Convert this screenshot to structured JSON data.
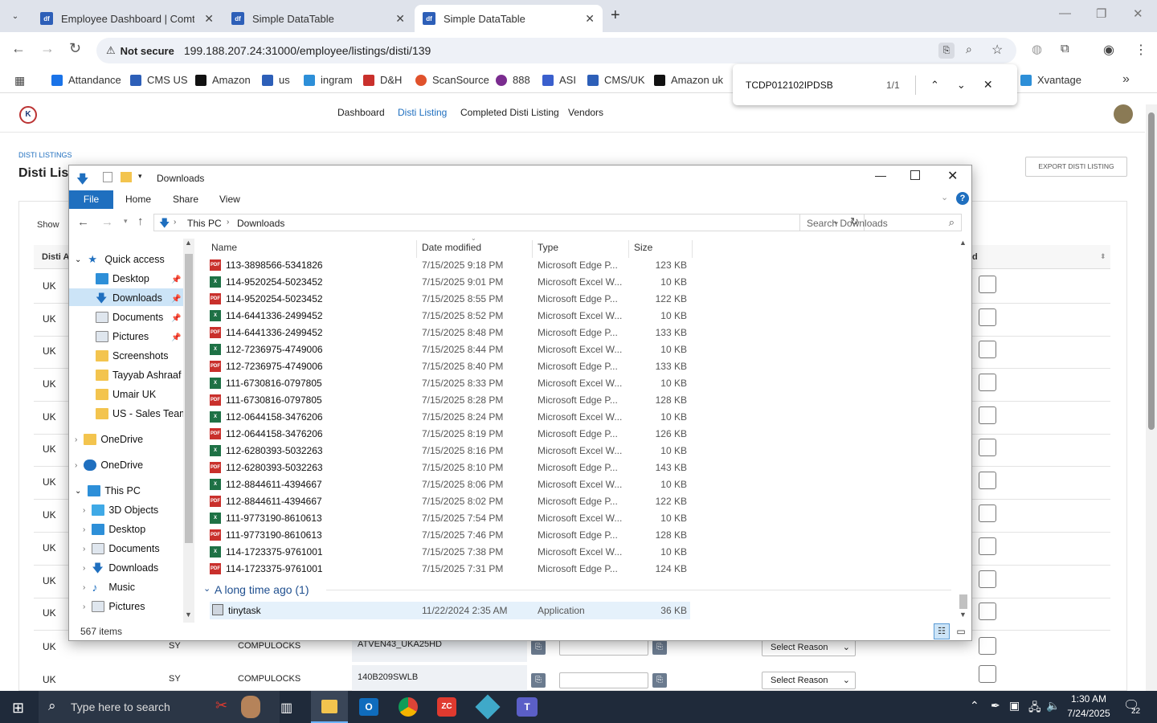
{
  "browser": {
    "tabs": [
      {
        "title": "Employee Dashboard | Comtan",
        "favicon": "df"
      },
      {
        "title": "Simple DataTable",
        "favicon": "df"
      },
      {
        "title": "Simple DataTable",
        "favicon": "df"
      }
    ],
    "new_tab": "+",
    "security": "Not secure",
    "url": "199.188.207.24:31000/employee/listings/disti/139",
    "bookmarks": [
      "Attandance",
      "CMS US",
      "Amazon",
      "us",
      "ingram",
      "D&H",
      "ScanSource",
      "888",
      "ASI",
      "CMS/UK",
      "Amazon uk",
      "Xvantage"
    ],
    "more": "»"
  },
  "findbar": {
    "query": "TCDP012102IPDSB",
    "count": "1/1"
  },
  "page": {
    "nav": [
      "Dashboard",
      "Disti Listing",
      "Completed Disti Listing",
      "Vendors"
    ],
    "section_label": "DISTI LISTINGS",
    "title": "Disti Listi",
    "export_button": "EXPORT DISTI LISTING",
    "show_label": "Show",
    "col_first": "Disti A",
    "col_last": "d",
    "rows_uk": [
      "UK",
      "UK",
      "UK",
      "UK",
      "UK",
      "UK",
      "UK",
      "UK",
      "UK",
      "UK",
      "UK"
    ],
    "bottom_rows": [
      {
        "country": "UK",
        "code": "SY",
        "vendor": "COMPULOCKS",
        "sku": "ATVEN43_UKA25HD",
        "reason": "Select Reason"
      },
      {
        "country": "UK",
        "code": "SY",
        "vendor": "COMPULOCKS",
        "sku": "140B209SWLB",
        "reason": "Select Reason"
      }
    ]
  },
  "explorer": {
    "title": "Downloads",
    "ribbon_tabs": [
      "File",
      "Home",
      "Share",
      "View"
    ],
    "path": [
      "This PC",
      "Downloads"
    ],
    "search_placeholder": "Search Downloads",
    "tree": {
      "quick_access": "Quick access",
      "quick_items": [
        "Desktop",
        "Downloads",
        "Documents",
        "Pictures",
        "Screenshots",
        "Tayyab Ashraaf",
        "Umair UK",
        "US - Sales Team"
      ],
      "onedrive1": "OneDrive",
      "onedrive2": "OneDrive",
      "this_pc": "This PC",
      "pc_items": [
        "3D Objects",
        "Desktop",
        "Documents",
        "Downloads",
        "Music",
        "Pictures"
      ]
    },
    "columns": {
      "name": "Name",
      "date": "Date modified",
      "type": "Type",
      "size": "Size"
    },
    "files": [
      {
        "name": "113-3898566-5341826",
        "date": "7/15/2025 9:18 PM",
        "type": "Microsoft Edge P...",
        "size": "123 KB",
        "kind": "pdf"
      },
      {
        "name": "114-9520254-5023452",
        "date": "7/15/2025 9:01 PM",
        "type": "Microsoft Excel W...",
        "size": "10 KB",
        "kind": "xls"
      },
      {
        "name": "114-9520254-5023452",
        "date": "7/15/2025 8:55 PM",
        "type": "Microsoft Edge P...",
        "size": "122 KB",
        "kind": "pdf"
      },
      {
        "name": "114-6441336-2499452",
        "date": "7/15/2025 8:52 PM",
        "type": "Microsoft Excel W...",
        "size": "10 KB",
        "kind": "xls"
      },
      {
        "name": "114-6441336-2499452",
        "date": "7/15/2025 8:48 PM",
        "type": "Microsoft Edge P...",
        "size": "133 KB",
        "kind": "pdf"
      },
      {
        "name": "112-7236975-4749006",
        "date": "7/15/2025 8:44 PM",
        "type": "Microsoft Excel W...",
        "size": "10 KB",
        "kind": "xls"
      },
      {
        "name": "112-7236975-4749006",
        "date": "7/15/2025 8:40 PM",
        "type": "Microsoft Edge P...",
        "size": "133 KB",
        "kind": "pdf"
      },
      {
        "name": "111-6730816-0797805",
        "date": "7/15/2025 8:33 PM",
        "type": "Microsoft Excel W...",
        "size": "10 KB",
        "kind": "xls"
      },
      {
        "name": "111-6730816-0797805",
        "date": "7/15/2025 8:28 PM",
        "type": "Microsoft Edge P...",
        "size": "128 KB",
        "kind": "pdf"
      },
      {
        "name": "112-0644158-3476206",
        "date": "7/15/2025 8:24 PM",
        "type": "Microsoft Excel W...",
        "size": "10 KB",
        "kind": "xls"
      },
      {
        "name": "112-0644158-3476206",
        "date": "7/15/2025 8:19 PM",
        "type": "Microsoft Edge P...",
        "size": "126 KB",
        "kind": "pdf"
      },
      {
        "name": "112-6280393-5032263",
        "date": "7/15/2025 8:16 PM",
        "type": "Microsoft Excel W...",
        "size": "10 KB",
        "kind": "xls"
      },
      {
        "name": "112-6280393-5032263",
        "date": "7/15/2025 8:10 PM",
        "type": "Microsoft Edge P...",
        "size": "143 KB",
        "kind": "pdf"
      },
      {
        "name": "112-8844611-4394667",
        "date": "7/15/2025 8:06 PM",
        "type": "Microsoft Excel W...",
        "size": "10 KB",
        "kind": "xls"
      },
      {
        "name": "112-8844611-4394667",
        "date": "7/15/2025 8:02 PM",
        "type": "Microsoft Edge P...",
        "size": "122 KB",
        "kind": "pdf"
      },
      {
        "name": "111-9773190-8610613",
        "date": "7/15/2025 7:54 PM",
        "type": "Microsoft Excel W...",
        "size": "10 KB",
        "kind": "xls"
      },
      {
        "name": "111-9773190-8610613",
        "date": "7/15/2025 7:46 PM",
        "type": "Microsoft Edge P...",
        "size": "128 KB",
        "kind": "pdf"
      },
      {
        "name": "114-1723375-9761001",
        "date": "7/15/2025 7:38 PM",
        "type": "Microsoft Excel W...",
        "size": "10 KB",
        "kind": "xls"
      },
      {
        "name": "114-1723375-9761001",
        "date": "7/15/2025 7:31 PM",
        "type": "Microsoft Edge P...",
        "size": "124 KB",
        "kind": "pdf"
      }
    ],
    "group_label": "A long time ago (1)",
    "old_file": {
      "name": "tinytask",
      "date": "11/22/2024 2:35 AM",
      "type": "Application",
      "size": "36 KB"
    },
    "status": "567 items"
  },
  "taskbar": {
    "search_placeholder": "Type here to search",
    "time": "1:30 AM",
    "date": "7/24/2025",
    "notifications": "22"
  },
  "colors": {
    "pdf": "#c9302c",
    "xls": "#1e7145",
    "folder": "#f3c44e",
    "accent": "#1f6fbf"
  }
}
